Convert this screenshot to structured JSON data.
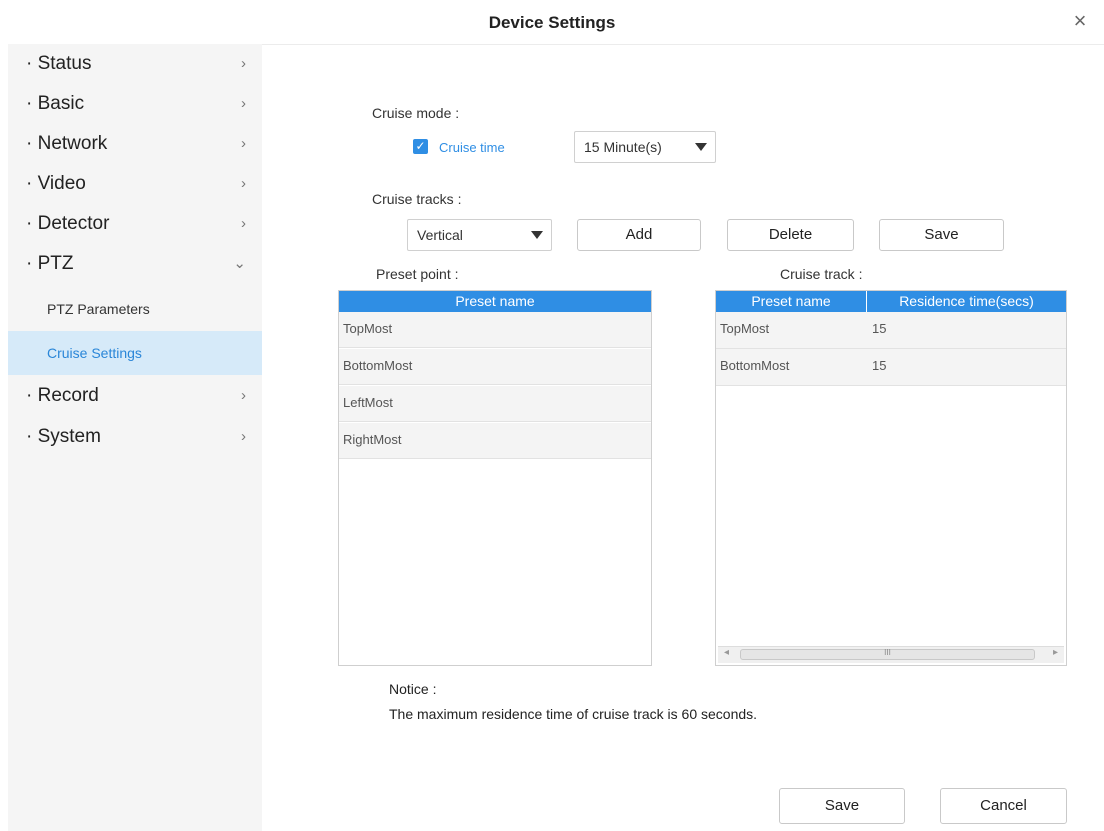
{
  "window": {
    "title": "Device Settings",
    "close_glyph": "×"
  },
  "sidebar": {
    "items": [
      {
        "label": "· Status",
        "chevron": "›"
      },
      {
        "label": "· Basic",
        "chevron": "›"
      },
      {
        "label": "· Network",
        "chevron": "›"
      },
      {
        "label": "· Video",
        "chevron": "›"
      },
      {
        "label": "· Detector",
        "chevron": "›"
      },
      {
        "label": "· PTZ",
        "chevron": "⌄"
      },
      {
        "label": "· Record",
        "chevron": "›"
      },
      {
        "label": "· System",
        "chevron": "›"
      }
    ],
    "ptz_sub": [
      "PTZ Parameters",
      "Cruise Settings"
    ],
    "active_sub": "Cruise Settings"
  },
  "cruise_mode": {
    "label": "Cruise mode :",
    "checkbox_label": "Cruise time",
    "checked": true,
    "time_value": "15 Minute(s)"
  },
  "cruise_tracks": {
    "label": "Cruise tracks :",
    "track_value": "Vertical",
    "add_label": "Add",
    "delete_label": "Delete",
    "save_label": "Save"
  },
  "preset_point": {
    "label": "Preset point :",
    "header": "Preset name",
    "rows": [
      "TopMost",
      "BottomMost",
      "LeftMost",
      "RightMost"
    ]
  },
  "cruise_track": {
    "label": "Cruise track :",
    "headers": [
      "Preset name",
      "Residence time(secs)"
    ],
    "rows": [
      {
        "name": "TopMost",
        "time": "15"
      },
      {
        "name": "BottomMost",
        "time": "15"
      }
    ],
    "scroll_glyph": "III"
  },
  "notice": {
    "title": "Notice :",
    "text": "The maximum residence time of cruise track is 60 seconds."
  },
  "footer": {
    "save_label": "Save",
    "cancel_label": "Cancel"
  },
  "colors": {
    "accent": "#2f8ee4",
    "active_bg": "#d6eaf9",
    "sidebar_bg": "#f5f5f5"
  }
}
